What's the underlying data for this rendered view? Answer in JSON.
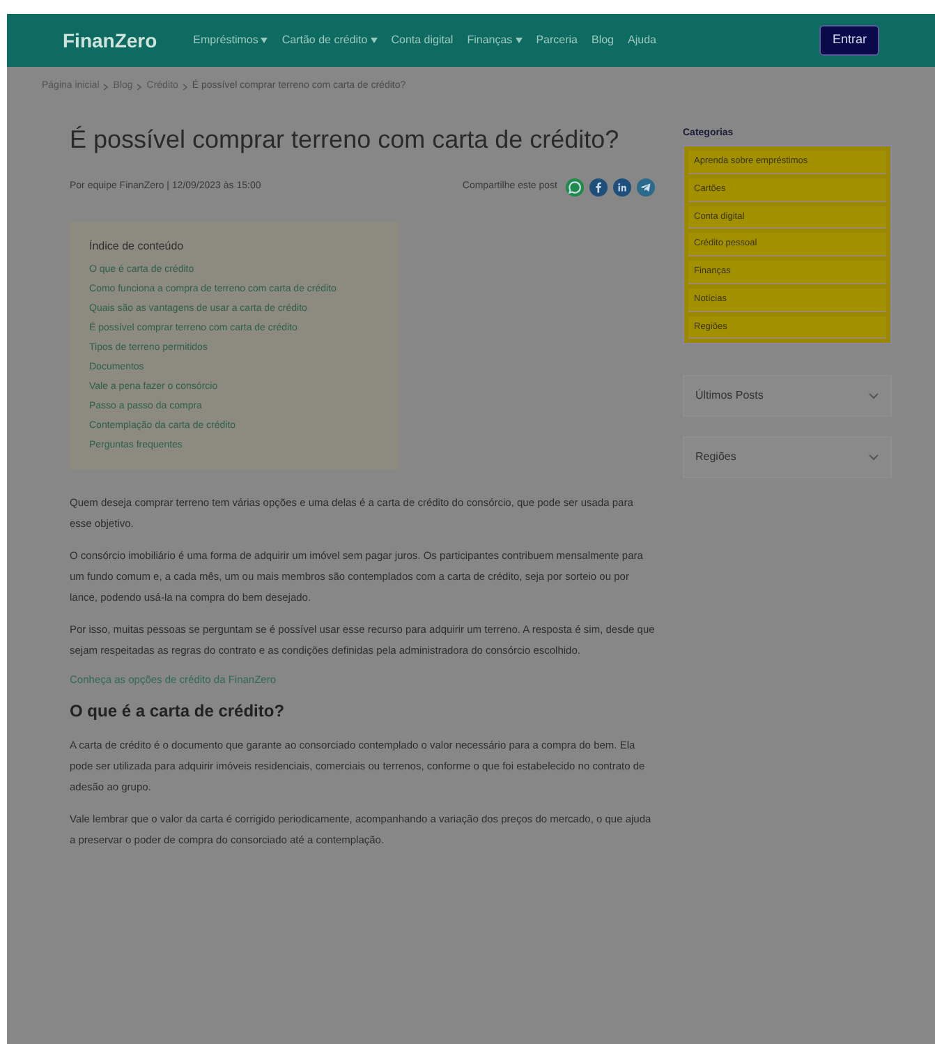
{
  "header": {
    "logo": "FinanZero",
    "nav": [
      {
        "label": "Empréstimos",
        "dropdown": true
      },
      {
        "label": "Cartão de crédito",
        "dropdown": true
      },
      {
        "label": "Conta digital",
        "dropdown": false
      },
      {
        "label": "Finanças",
        "dropdown": true
      },
      {
        "label": "Parceria",
        "dropdown": false
      },
      {
        "label": "Blog",
        "dropdown": false
      },
      {
        "label": "Ajuda",
        "dropdown": false
      }
    ],
    "button": "Entrar"
  },
  "breadcrumb": [
    "Página inicial",
    "Blog",
    "Crédito",
    "É possível comprar terreno com carta de crédito?"
  ],
  "article": {
    "title": "É possível comprar terreno com carta de crédito?",
    "byline": "Por equipe FinanZero | 12/09/2023 às 15:00",
    "share_label": "Compartilhe este post",
    "share": [
      {
        "kind": "whatsapp",
        "color": "#1f8a4c"
      },
      {
        "kind": "facebook",
        "color": "#1d4f7a"
      },
      {
        "kind": "linkedin",
        "color": "#1d4f7a"
      },
      {
        "kind": "telegram",
        "color": "#2a6a8a"
      }
    ],
    "toc": {
      "title": "Índice de conteúdo",
      "items": [
        "O que é carta de crédito",
        "Como funciona a compra de terreno com carta de crédito",
        "Quais são as vantagens de usar a carta de crédito",
        "É possível comprar terreno com carta de crédito",
        "Tipos de terreno permitidos",
        "Documentos",
        "Vale a pena fazer o consórcio",
        "Passo a passo da compra",
        "Contemplação da carta de crédito",
        "Perguntas frequentes"
      ]
    },
    "blocks": [
      {
        "kind": "paragraph",
        "text": "Quem deseja comprar terreno tem várias opções e uma delas é a carta de crédito do consórcio, que pode ser usada para esse objetivo."
      },
      {
        "kind": "paragraph",
        "text": "O consórcio imobiliário é uma forma de adquirir um imóvel sem pagar juros. Os participantes contribuem mensalmente para um fundo comum e, a cada mês, um ou mais membros são contemplados com a carta de crédito, seja por sorteio ou por lance, podendo usá-la na compra do bem desejado."
      },
      {
        "kind": "paragraph",
        "text": "Por isso, muitas pessoas se perguntam se é possível usar esse recurso para adquirir um terreno. A resposta é sim, desde que sejam respeitadas as regras do contrato e as condições definidas pela administradora do consórcio escolhido."
      },
      {
        "kind": "link",
        "text": "Conheça as opções de crédito da FinanZero"
      },
      {
        "kind": "heading",
        "text": "O que é a carta de crédito?"
      },
      {
        "kind": "paragraph",
        "text": "A carta de crédito é o documento que garante ao consorciado contemplado o valor necessário para a compra do bem. Ela pode ser utilizada para adquirir imóveis residenciais, comerciais ou terrenos, conforme o que foi estabelecido no contrato de adesão ao grupo."
      },
      {
        "kind": "paragraph",
        "text": "Vale lembrar que o valor da carta é corrigido periodicamente, acompanhando a variação dos preços do mercado, o que ajuda a preservar o poder de compra do consorciado até a contemplação."
      }
    ]
  },
  "sidebar": {
    "categories_title": "Categorias",
    "categories": [
      "Aprenda sobre empréstimos",
      "Cartões",
      "Conta digital",
      "Crédito pessoal",
      "Finanças",
      "Notícias",
      "Regiões"
    ],
    "accordions": [
      {
        "label": "Últimos Posts",
        "expanded": false
      },
      {
        "label": "Regiões",
        "expanded": false
      }
    ]
  }
}
